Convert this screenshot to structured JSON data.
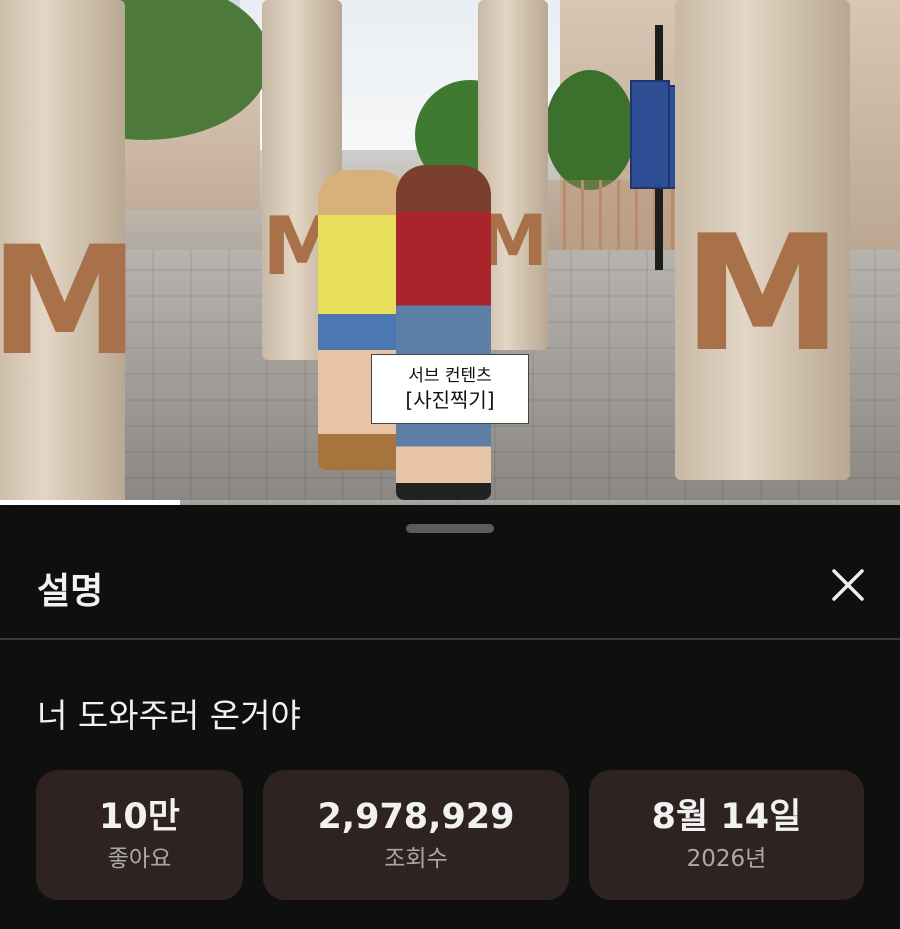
{
  "video": {
    "subtitle_line1": "서브 컨텐츠",
    "subtitle_line2": "[사진찍기]",
    "progress": 0.2
  },
  "sheet": {
    "title": "설명",
    "video_title": "너 도와주러 온거야",
    "stats": [
      {
        "value": "10만",
        "label": "좋아요"
      },
      {
        "value": "2,978,929",
        "label": "조회수"
      },
      {
        "value": "8월 14일",
        "label": "2026년"
      }
    ]
  },
  "colors": {
    "background": "#0f0f0f",
    "stat_card": "#2e2320",
    "text_primary": "#f1f1f1",
    "text_secondary": "#aaaaaa"
  },
  "icons": {
    "close": "close-icon"
  }
}
